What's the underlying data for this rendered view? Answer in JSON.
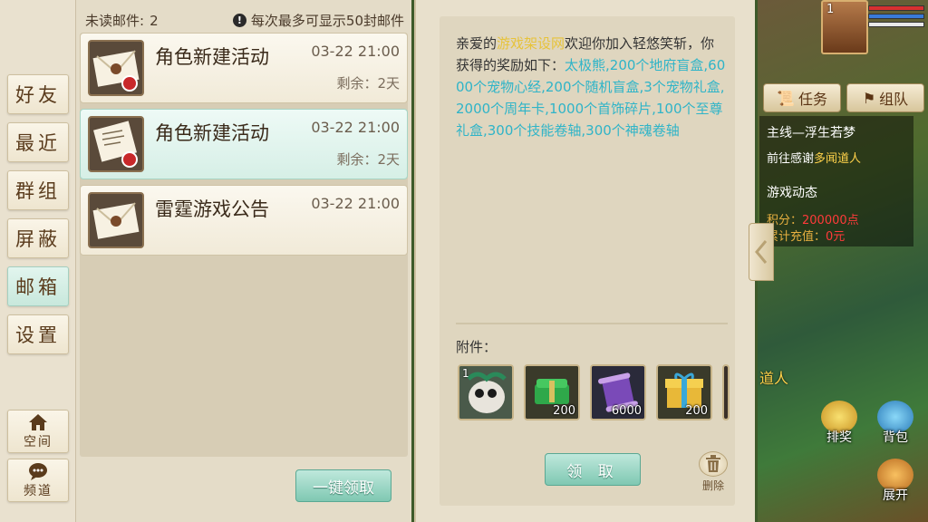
{
  "nav": {
    "tabs": [
      {
        "label": "好友"
      },
      {
        "label": "最近"
      },
      {
        "label": "群组"
      },
      {
        "label": "屏蔽"
      },
      {
        "label": "邮箱"
      },
      {
        "label": "设置"
      }
    ],
    "space_label": "空间",
    "channel_label": "频道"
  },
  "list": {
    "unread_label": "未读邮件:",
    "unread_count": "2",
    "limit_note": "每次最多可显示50封邮件",
    "mails": [
      {
        "title": "角色新建活动",
        "date": "03-22 21:00",
        "remain": "剩余：2天"
      },
      {
        "title": "角色新建活动",
        "date": "03-22 21:00",
        "remain": "剩余：2天"
      },
      {
        "title": "雷霆游戏公告",
        "date": "03-22 21:00",
        "remain": ""
      }
    ],
    "claim_all_label": "一键领取"
  },
  "detail": {
    "body_prefix": "亲爱的",
    "body_site": "游戏架设网",
    "body_mid": "欢迎你加入轻悠笑斩，你获得的奖励如下：",
    "body_rewards": "太极熊,200个地府盲盒,6000个宠物心经,200个随机盲盒,3个宠物礼盒,2000个周年卡,1000个首饰碎片,100个至尊礼盒,300个技能卷轴,300个神魂卷轴",
    "attach_label": "附件：",
    "attachments": [
      {
        "badge": "1",
        "count": ""
      },
      {
        "badge": "",
        "count": "200"
      },
      {
        "badge": "",
        "count": "6000"
      },
      {
        "badge": "",
        "count": "200"
      }
    ],
    "receive_label": "领 取",
    "delete_label": "删除"
  },
  "hud": {
    "level": "1",
    "quest_btn": "任务",
    "team_btn": "组队",
    "quest_main": "主线—浮生若梦",
    "quest_sub_prefix": "前往感谢",
    "quest_npc": "多闻道人",
    "dynamics_title": "游戏动态",
    "points_label": "积分：",
    "points_value": "200000点",
    "charge_label": "累计充值：",
    "charge_value": "0元",
    "npc_label": "道人",
    "rank_label": "排奖",
    "bag_label": "背包",
    "expand_label": "展开"
  },
  "colors": {
    "highlight_yellow": "#e7c33a",
    "highlight_cyan": "#2fb4c8",
    "button_green": "#7fc8b2"
  }
}
